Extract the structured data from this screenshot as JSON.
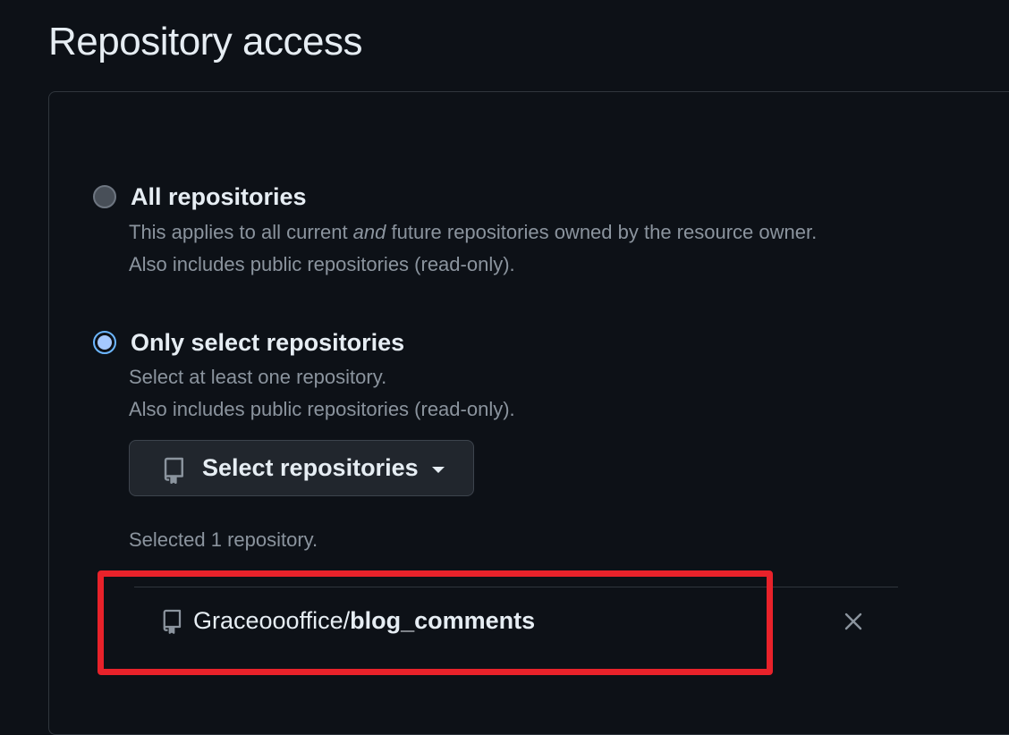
{
  "page": {
    "title": "Repository access"
  },
  "options": {
    "all": {
      "title": "All repositories",
      "desc_before": "This applies to all current ",
      "desc_em": "and",
      "desc_after": " future repositories owned by the resource owner.",
      "desc_line2": "Also includes public repositories (read-only).",
      "checked": false
    },
    "select": {
      "title": "Only select repositories",
      "desc_line1": "Select at least one repository.",
      "desc_line2": "Also includes public repositories (read-only).",
      "checked": true
    }
  },
  "select_button": {
    "label": "Select repositories",
    "icon": "repo-icon"
  },
  "selection": {
    "count_text": "Selected 1 repository.",
    "repos": [
      {
        "owner": "Graceoooffice/",
        "name": "blog_comments",
        "icon": "repo-icon",
        "remove_icon": "close-icon"
      }
    ]
  },
  "colors": {
    "background": "#0d1117",
    "border": "#30363d",
    "text": "#e6edf3",
    "muted": "#8b949e",
    "accent_radio": "#6cb6ff",
    "highlight": "#e8222a"
  }
}
